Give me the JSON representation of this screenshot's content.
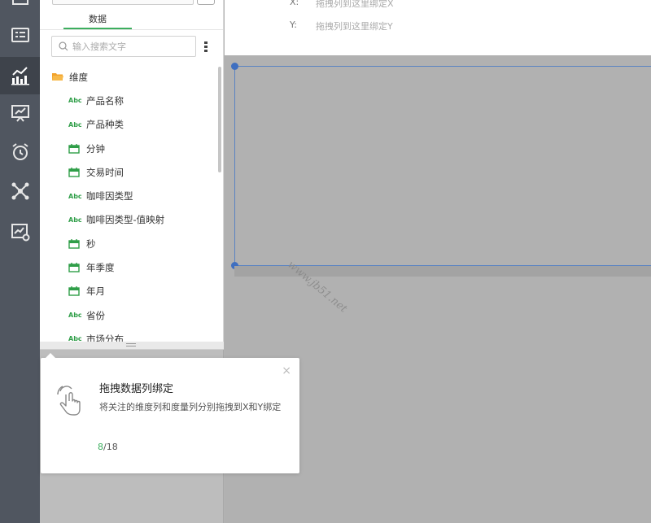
{
  "navbar": {
    "items": [
      {
        "icon": "grid-icon",
        "active": false
      },
      {
        "icon": "list-card-icon",
        "active": false
      },
      {
        "icon": "chart-analysis-icon",
        "active": true
      },
      {
        "icon": "presentation-icon",
        "active": false
      },
      {
        "icon": "alarm-clock-icon",
        "active": false
      },
      {
        "icon": "network-icon",
        "active": false
      },
      {
        "icon": "report-settings-icon",
        "active": false
      }
    ]
  },
  "data_panel": {
    "tab_label": "数据",
    "search_placeholder": "输入搜索文字",
    "folder_label": "维度",
    "fields": [
      {
        "type": "abc",
        "label": "产品名称"
      },
      {
        "type": "abc",
        "label": "产品种类"
      },
      {
        "type": "date",
        "label": "分钟"
      },
      {
        "type": "date",
        "label": "交易时间"
      },
      {
        "type": "abc",
        "label": "咖啡因类型"
      },
      {
        "type": "abc",
        "label": "咖啡因类型-值映射"
      },
      {
        "type": "date",
        "label": "秒"
      },
      {
        "type": "date",
        "label": "年季度"
      },
      {
        "type": "date",
        "label": "年月"
      },
      {
        "type": "abc",
        "label": "省份"
      },
      {
        "type": "abc",
        "label": "市场分布"
      }
    ],
    "abc_badge": "Abc"
  },
  "binding": {
    "x_label": "X:",
    "x_hint": "拖拽列到这里绑定X",
    "y_label": "Y:",
    "y_hint": "拖拽列到这里绑定Y"
  },
  "canvas": {
    "watermark": "www.jb51.net"
  },
  "tooltip": {
    "title": "拖拽数据列绑定",
    "description": "将关注的维度列和度量列分别拖拽到X和Y绑定",
    "step_current": "8",
    "step_total": "/18",
    "close": "×"
  },
  "colors": {
    "accent_green": "#3cae5e",
    "nav_bg": "#505660",
    "selection_blue": "#3f6fc0"
  }
}
